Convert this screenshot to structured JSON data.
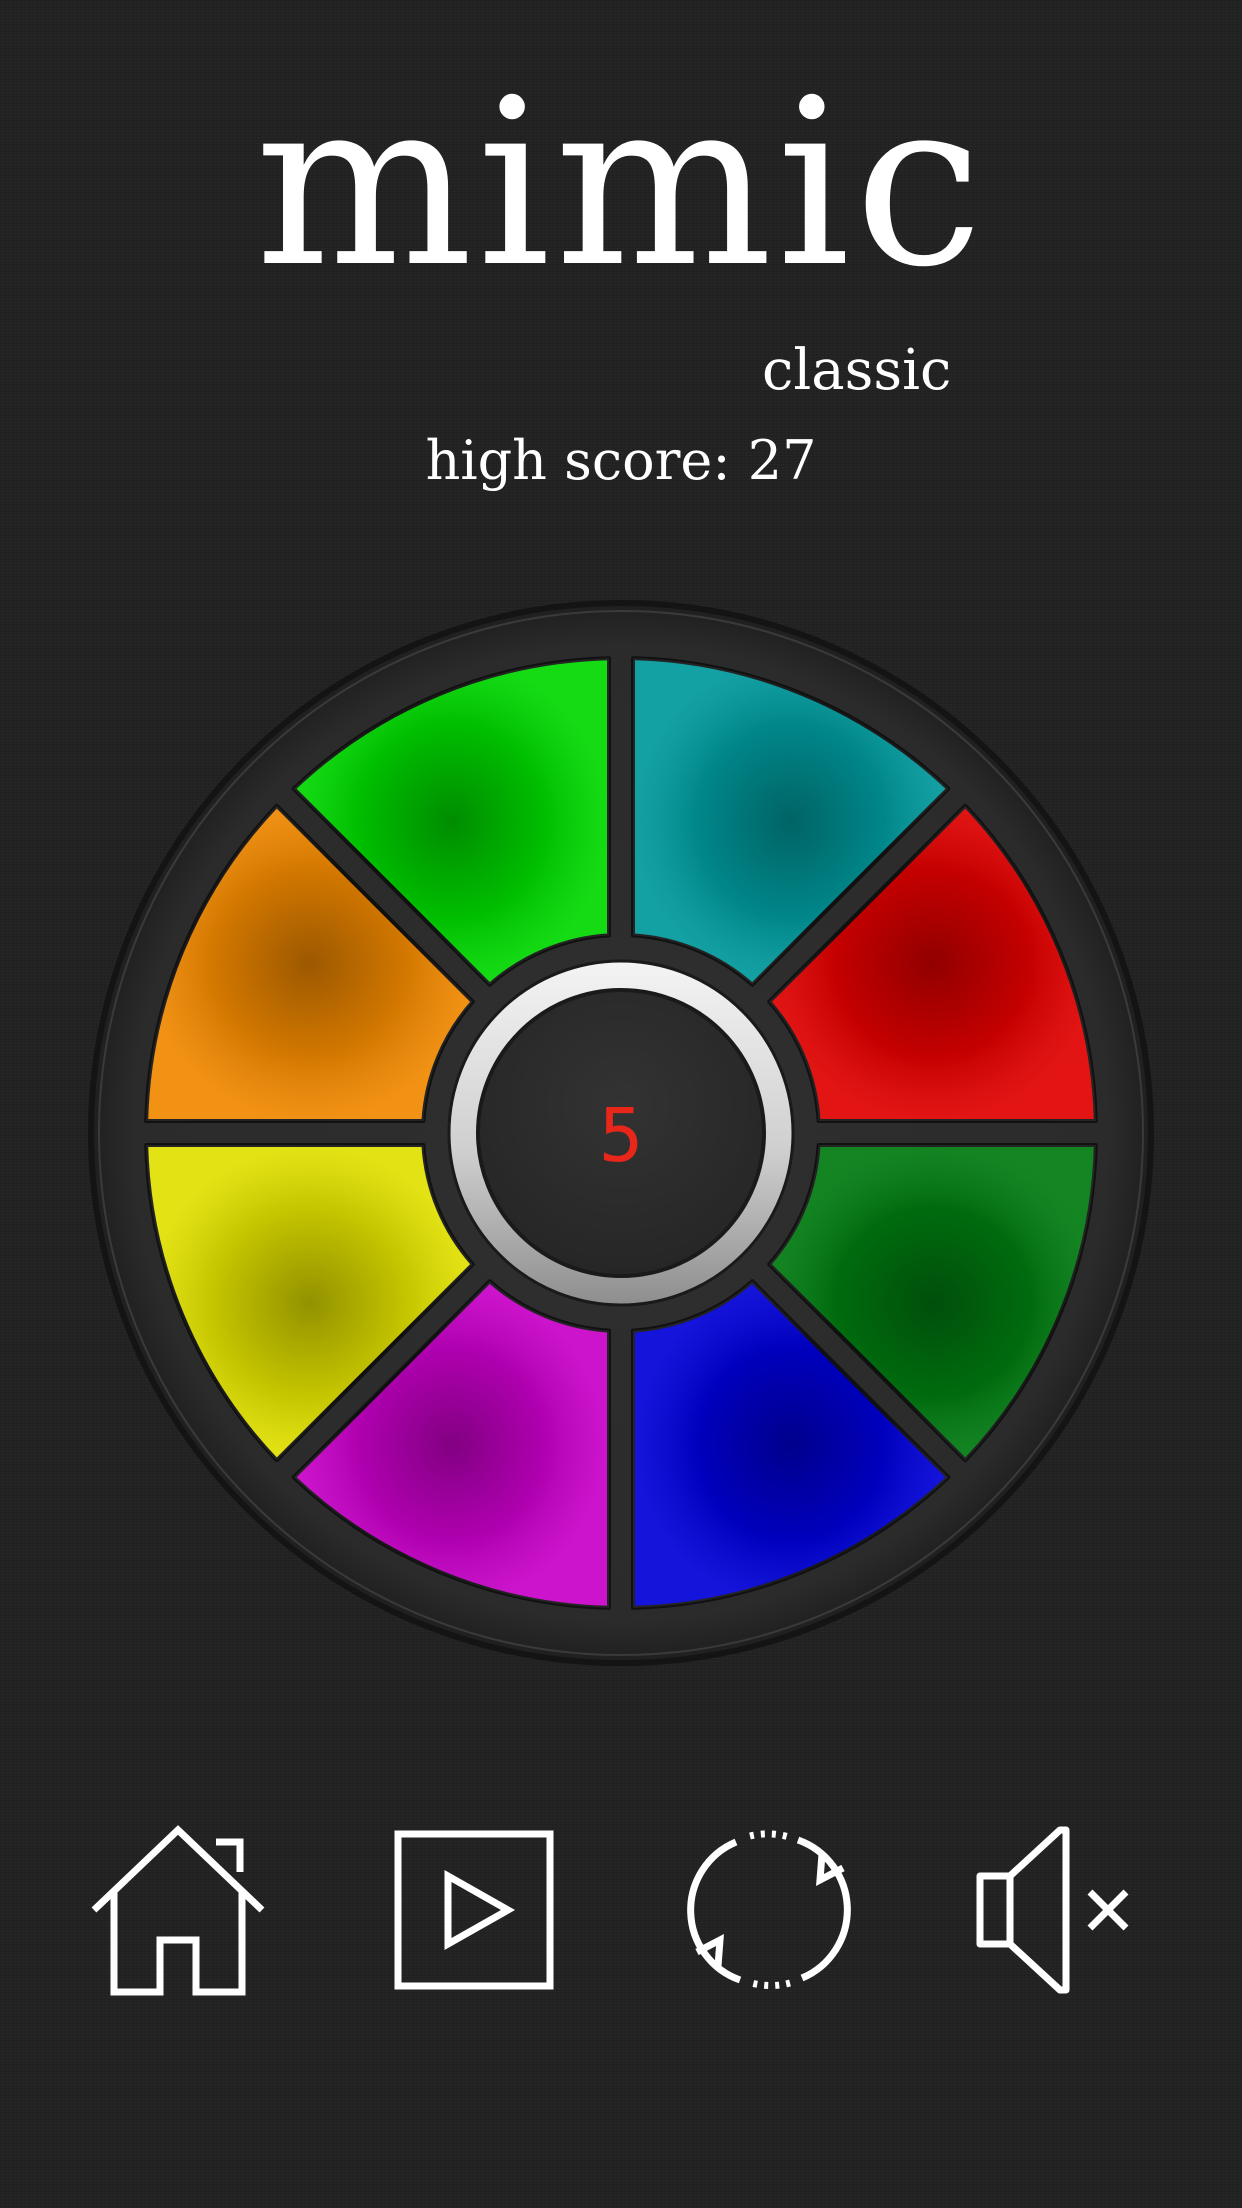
{
  "app": {
    "title": "mimic",
    "mode": "classic",
    "high_score": "high score: 27",
    "round": "5"
  },
  "pads": [
    {
      "id": "teal",
      "color": "#00999c"
    },
    {
      "id": "red",
      "color": "#e00000"
    },
    {
      "id": "dark-green",
      "color": "#007a10"
    },
    {
      "id": "blue",
      "color": "#0000d8"
    },
    {
      "id": "magenta",
      "color": "#c800c8"
    },
    {
      "id": "yellow",
      "color": "#e0e000"
    },
    {
      "id": "orange",
      "color": "#f08800"
    },
    {
      "id": "green",
      "color": "#00d800"
    }
  ],
  "toolbar": [
    {
      "id": "home",
      "icon": "home-icon"
    },
    {
      "id": "play",
      "icon": "play-icon"
    },
    {
      "id": "restart",
      "icon": "restart-icon"
    },
    {
      "id": "mute",
      "icon": "mute-icon"
    }
  ],
  "colors": {
    "background": "#222222",
    "ring": "#2c2c2c",
    "counter": "#e8261a",
    "text": "#ffffff"
  }
}
